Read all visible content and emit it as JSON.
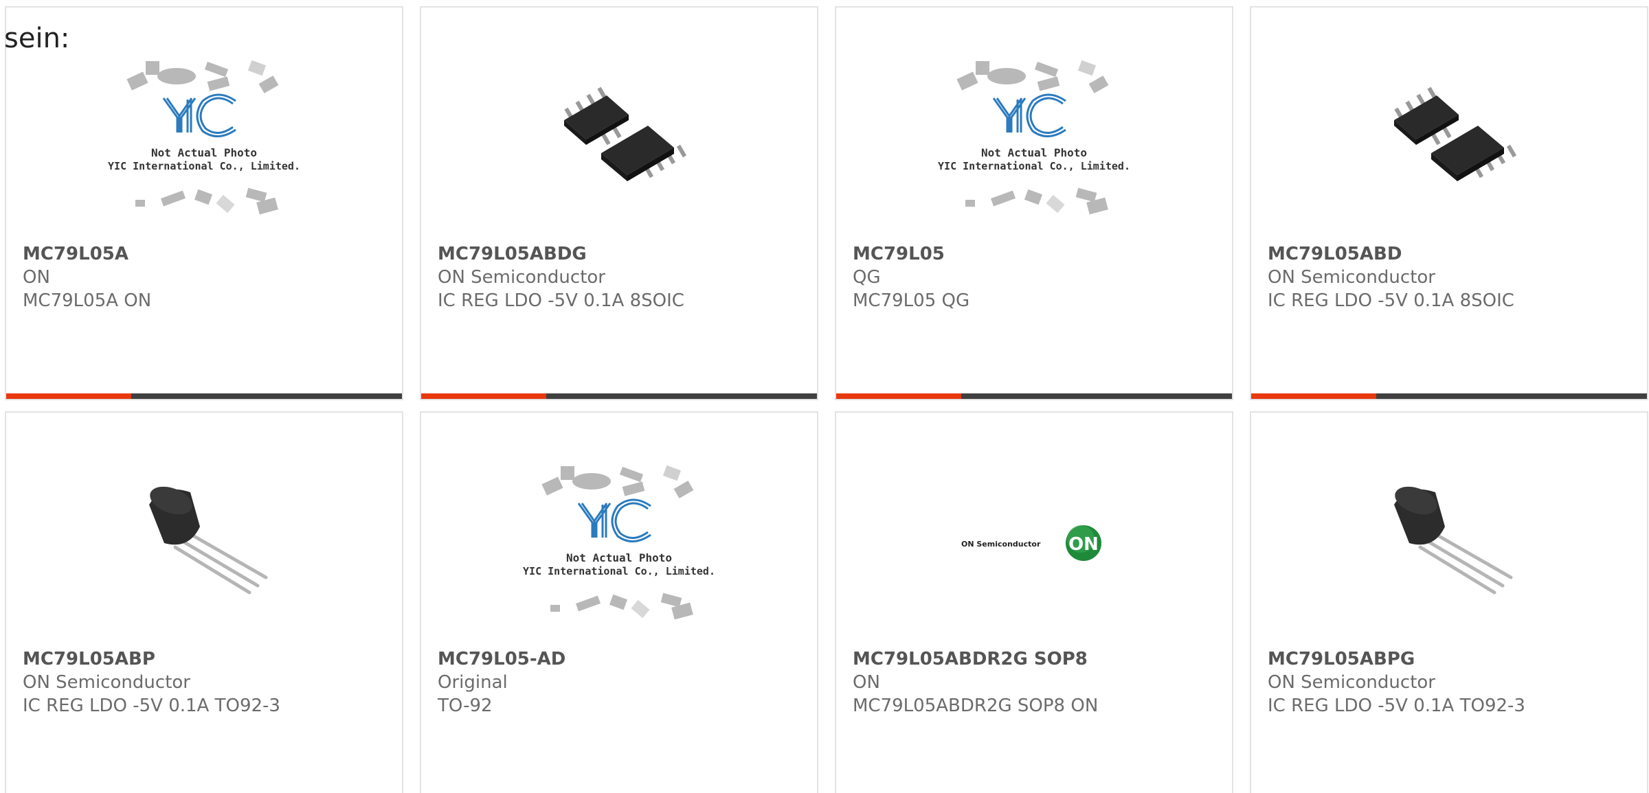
{
  "intro_text": "sein:",
  "colors": {
    "accent": "#e8380d",
    "bar": "#404040",
    "border": "#e3e3e3",
    "yic_logo": "#2b7bbf",
    "on_logo": "#1f8a3a"
  },
  "placeholder": {
    "line1": "Not Actual Photo",
    "line2": "YIC International Co., Limited."
  },
  "on_logo_text": "ON Semiconductor",
  "products": [
    {
      "part": "MC79L05A",
      "manufacturer": "ON",
      "description": "MC79L05A ON",
      "image": "yic-placeholder"
    },
    {
      "part": "MC79L05ABDG",
      "manufacturer": "ON Semiconductor",
      "description": "IC REG LDO -5V 0.1A 8SOIC",
      "image": "soic8-chip"
    },
    {
      "part": "MC79L05",
      "manufacturer": "QG",
      "description": "MC79L05 QG",
      "image": "yic-placeholder"
    },
    {
      "part": "MC79L05ABD",
      "manufacturer": "ON Semiconductor",
      "description": "IC REG LDO -5V 0.1A 8SOIC",
      "image": "soic8-chip"
    },
    {
      "part": "MC79L05ABP",
      "manufacturer": "ON Semiconductor",
      "description": "IC REG LDO -5V 0.1A TO92-3",
      "image": "to92-transistor"
    },
    {
      "part": "MC79L05-AD",
      "manufacturer": "Original",
      "description": "TO-92",
      "image": "yic-placeholder"
    },
    {
      "part": "MC79L05ABDR2G SOP8",
      "manufacturer": "ON",
      "description": "MC79L05ABDR2G SOP8 ON",
      "image": "on-semiconductor-logo"
    },
    {
      "part": "MC79L05ABPG",
      "manufacturer": "ON Semiconductor",
      "description": "IC REG LDO -5V 0.1A TO92-3",
      "image": "to92-transistor"
    }
  ]
}
